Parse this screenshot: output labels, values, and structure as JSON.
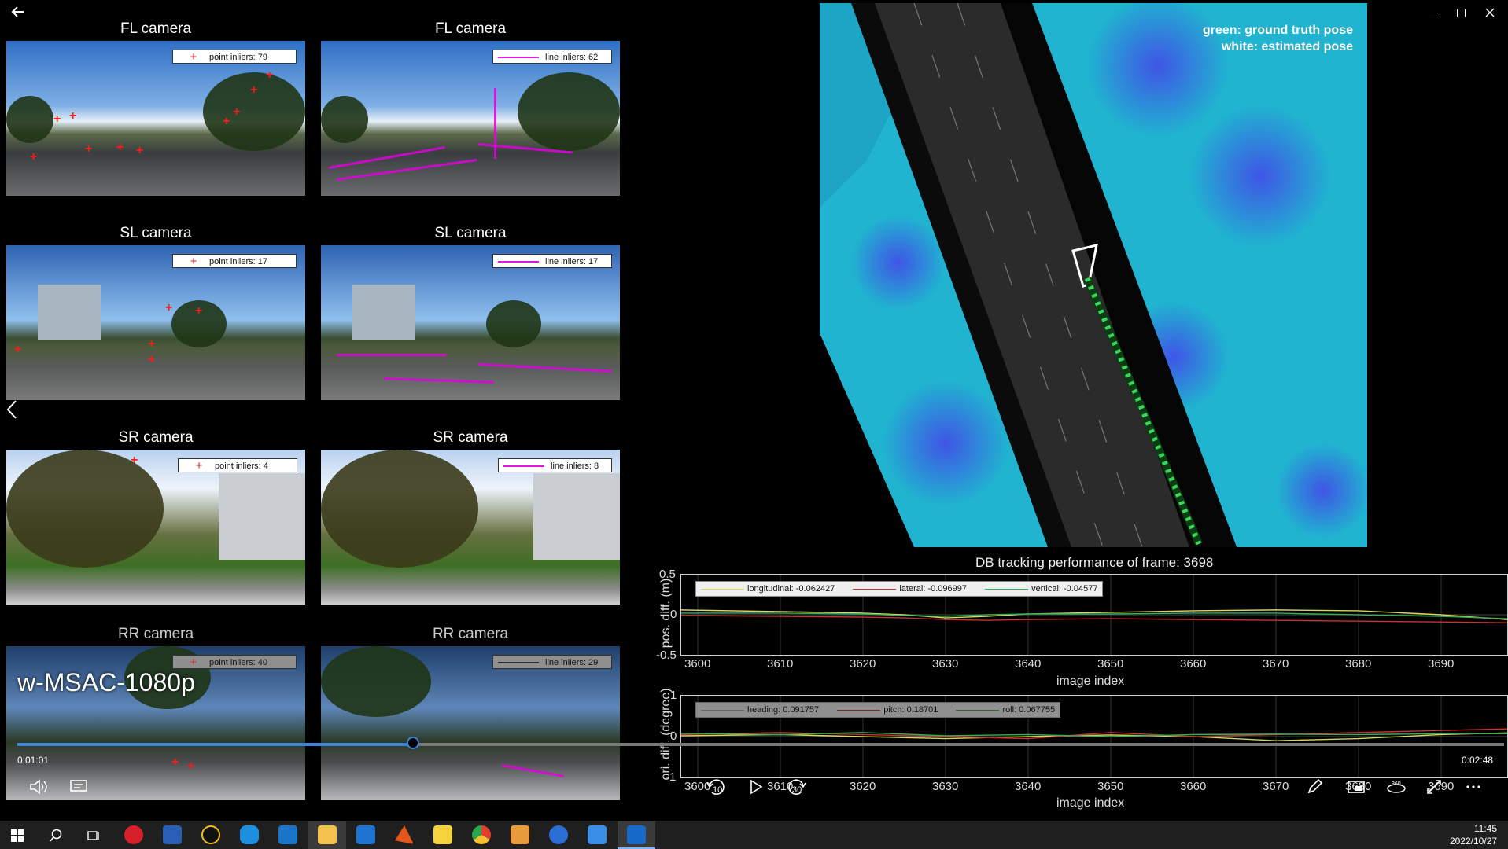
{
  "window": {
    "back_icon": "arrow-left-icon",
    "controls": [
      "minimize-icon",
      "restore-icon",
      "close-icon"
    ]
  },
  "cameras": [
    {
      "title": "FL camera",
      "legend": "point inliers: 79",
      "kind": "point"
    },
    {
      "title": "FL camera",
      "legend": "line inliers: 62",
      "kind": "line"
    },
    {
      "title": "SL camera",
      "legend": "point inliers: 17",
      "kind": "point"
    },
    {
      "title": "SL camera",
      "legend": "line inliers: 17",
      "kind": "line"
    },
    {
      "title": "SR camera",
      "legend": "point inliers: 4",
      "kind": "point"
    },
    {
      "title": "SR camera",
      "legend": "line inliers: 8",
      "kind": "line"
    },
    {
      "title": "RR camera",
      "legend": "point inliers: 40",
      "kind": "point"
    },
    {
      "title": "RR camera",
      "legend": "line inliers: 29",
      "kind": "line"
    }
  ],
  "map": {
    "legend_green": "green: ground truth pose",
    "legend_white": "white: estimated pose"
  },
  "video": {
    "title": "w-MSAC-1080p",
    "current_time": "0:01:01",
    "total_time": "0:02:48",
    "progress_fraction": 0.266,
    "skip_back_label": "10",
    "skip_forward_label": "30"
  },
  "chart_data": [
    {
      "type": "line",
      "title": "DB tracking performance of frame: 3698",
      "ylabel": "pos. diff. (m)",
      "xlabel": "image index",
      "xlim": [
        3598,
        3698
      ],
      "ylim": [
        -0.5,
        0.5
      ],
      "yticks": [
        "0.5",
        "0",
        "-0.5"
      ],
      "xticks": [
        "3600",
        "3610",
        "3620",
        "3630",
        "3640",
        "3650",
        "3660",
        "3670",
        "3680",
        "3690"
      ],
      "x": [
        3598,
        3610,
        3620,
        3625,
        3630,
        3635,
        3640,
        3650,
        3660,
        3670,
        3680,
        3690,
        3698
      ],
      "series": [
        {
          "name": "longitudinal: -0.062427",
          "color": "#d8d860",
          "values": [
            0.06,
            0.04,
            0.02,
            0.0,
            -0.04,
            -0.02,
            0.01,
            0.03,
            0.05,
            0.06,
            0.05,
            0.0,
            -0.06
          ]
        },
        {
          "name": "lateral: -0.096997",
          "color": "#c83232",
          "values": [
            -0.01,
            -0.02,
            -0.03,
            -0.04,
            -0.06,
            -0.07,
            -0.06,
            -0.05,
            -0.06,
            -0.07,
            -0.08,
            -0.09,
            -0.1
          ]
        },
        {
          "name": "vertical: -0.04577",
          "color": "#33b05a",
          "values": [
            0.02,
            0.02,
            0.01,
            -0.01,
            -0.02,
            0.0,
            0.01,
            0.01,
            0.02,
            0.02,
            0.0,
            -0.02,
            -0.05
          ]
        }
      ]
    },
    {
      "type": "line",
      "ylabel": "ori. diff. (degree)",
      "xlabel": "image index",
      "xlim": [
        3598,
        3698
      ],
      "ylim": [
        -1,
        1
      ],
      "yticks": [
        "1",
        "0",
        "-1"
      ],
      "xticks": [
        "3600",
        "3610",
        "3620",
        "3630",
        "3640",
        "3650",
        "3660",
        "3670",
        "3680",
        "3690"
      ],
      "x": [
        3598,
        3610,
        3620,
        3630,
        3640,
        3650,
        3660,
        3670,
        3680,
        3690,
        3698
      ],
      "series": [
        {
          "name": "heading: 0.091757",
          "color": "#d8d860",
          "values": [
            0.02,
            0.05,
            0.0,
            -0.05,
            0.0,
            0.04,
            0.0,
            -0.1,
            -0.05,
            0.05,
            0.09
          ]
        },
        {
          "name": "pitch: 0.18701",
          "color": "#c83232",
          "values": [
            0.05,
            0.1,
            0.05,
            0.0,
            -0.05,
            0.1,
            0.0,
            0.05,
            0.1,
            0.15,
            0.19
          ]
        },
        {
          "name": "roll: 0.067755",
          "color": "#33b05a",
          "values": [
            0.08,
            0.05,
            0.1,
            0.02,
            0.05,
            0.0,
            0.05,
            0.06,
            0.05,
            0.07,
            0.07
          ]
        }
      ]
    }
  ],
  "taskbar": {
    "time": "11:45",
    "date": "2022/10/27",
    "apps": [
      "windows-start-icon",
      "search-icon",
      "task-view-icon",
      "netease-music-icon",
      "word-icon",
      "qq-icon",
      "app-icon",
      "vscode-icon",
      "file-explorer-icon",
      "mail-icon",
      "matlab-icon",
      "sticky-notes-icon",
      "chrome-icon",
      "photos-icon",
      "app-icon-2",
      "app-icon-3",
      "video-player-icon"
    ]
  }
}
